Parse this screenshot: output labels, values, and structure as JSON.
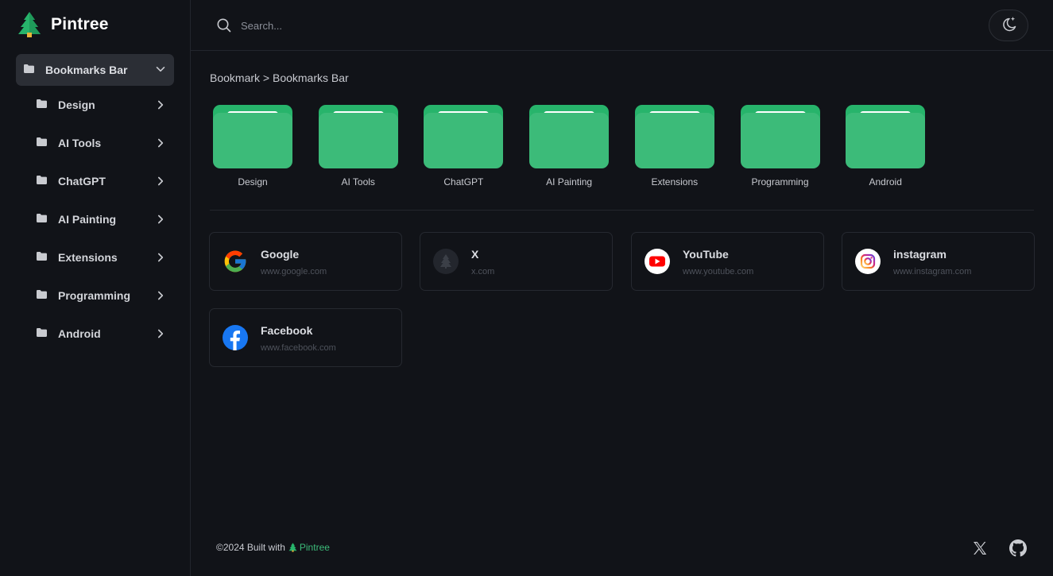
{
  "app": {
    "name": "Pintree",
    "brand_color": "#3cbb79"
  },
  "sidebar": {
    "root": {
      "label": "Bookmarks Bar",
      "icon": "folder-icon",
      "expanded": true
    },
    "items": [
      {
        "label": "Design"
      },
      {
        "label": "AI Tools"
      },
      {
        "label": "ChatGPT"
      },
      {
        "label": "AI Painting"
      },
      {
        "label": "Extensions"
      },
      {
        "label": "Programming"
      },
      {
        "label": "Android"
      }
    ]
  },
  "header": {
    "search": {
      "placeholder": "Search...",
      "value": ""
    },
    "theme_toggle_icon": "moon-sparkle-icon"
  },
  "breadcrumb": {
    "text": "Bookmark > Bookmarks Bar"
  },
  "folders": [
    {
      "name": "Design"
    },
    {
      "name": "AI Tools"
    },
    {
      "name": "ChatGPT"
    },
    {
      "name": "AI Painting"
    },
    {
      "name": "Extensions"
    },
    {
      "name": "Programming"
    },
    {
      "name": "Android"
    }
  ],
  "bookmarks": [
    {
      "title": "Google",
      "url": "www.google.com",
      "icon": "google-icon"
    },
    {
      "title": "X",
      "url": "x.com",
      "icon": "tree-placeholder-icon"
    },
    {
      "title": "YouTube",
      "url": "www.youtube.com",
      "icon": "youtube-icon"
    },
    {
      "title": "instagram",
      "url": "www.instagram.com",
      "icon": "instagram-icon"
    },
    {
      "title": "Facebook",
      "url": "www.facebook.com",
      "icon": "facebook-icon"
    }
  ],
  "footer": {
    "text": "©2024 Built with",
    "link_label": "Pintree",
    "social": [
      "x-icon",
      "github-icon"
    ]
  },
  "colors": {
    "background": "#111318",
    "folder": "#3cbb79",
    "folder_tab": "#27b46b"
  }
}
